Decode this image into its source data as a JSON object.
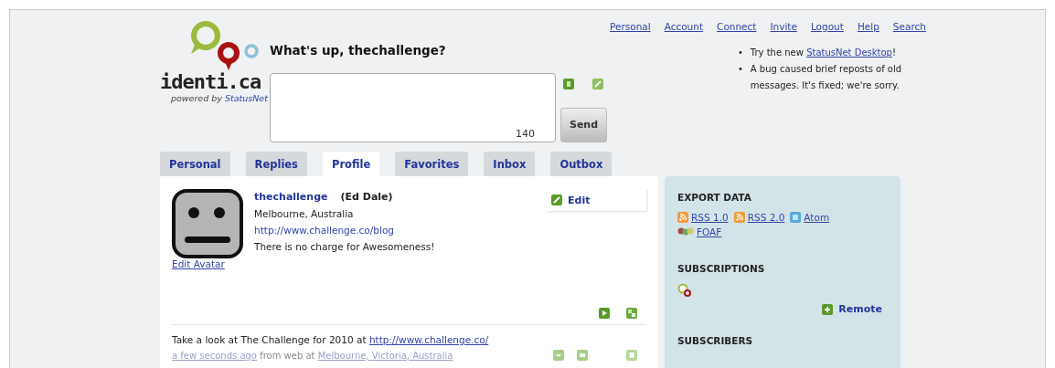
{
  "logo": {
    "wordmark": "identi.ca",
    "powered_prefix": "powered by",
    "powered_link": "StatusNet"
  },
  "nav": [
    "Personal",
    "Account",
    "Connect",
    "Invite",
    "Logout",
    "Help",
    "Search"
  ],
  "status_form": {
    "prompt": "What's up, thechallenge?",
    "counter": "140",
    "send": "Send"
  },
  "notices": [
    {
      "marker": "•",
      "before": "Try the new",
      "link": "StatusNet Desktop",
      "after": "!"
    },
    {
      "marker": "•",
      "before": "A bug caused brief reposts of old messages. It's fixed; we're sorry."
    }
  ],
  "tabs": [
    {
      "label": "Personal",
      "selected": false
    },
    {
      "label": "Replies",
      "selected": false
    },
    {
      "label": "Profile",
      "selected": true
    },
    {
      "label": "Favorites",
      "selected": false
    },
    {
      "label": "Inbox",
      "selected": false
    },
    {
      "label": "Outbox",
      "selected": false
    }
  ],
  "profile": {
    "nickname": "thechallenge",
    "fullname": "(Ed Dale)",
    "location": "Melbourne, Australia",
    "homepage": "http://www.challenge.co/blog",
    "bio": "There is no charge for Awesomeness!",
    "edit_avatar": "Edit Avatar",
    "edit": "Edit"
  },
  "notice": {
    "text": "Take a look at The Challenge for 2010 at",
    "link": "http://www.challenge.co/",
    "time": "a few seconds ago",
    "via": "from web at",
    "place": "Melbourne, Victoria, Australia"
  },
  "sidebar": {
    "export_title": "EXPORT DATA",
    "feeds": [
      {
        "kind": "rss",
        "label": "RSS 1.0"
      },
      {
        "kind": "rss",
        "label": "RSS 2.0"
      },
      {
        "kind": "atom",
        "label": "Atom"
      },
      {
        "kind": "foaf",
        "label": "FOAF"
      }
    ],
    "subscriptions_title": "SUBSCRIPTIONS",
    "remote": "Remote",
    "subscribers_title": "SUBSCRIBERS"
  }
}
